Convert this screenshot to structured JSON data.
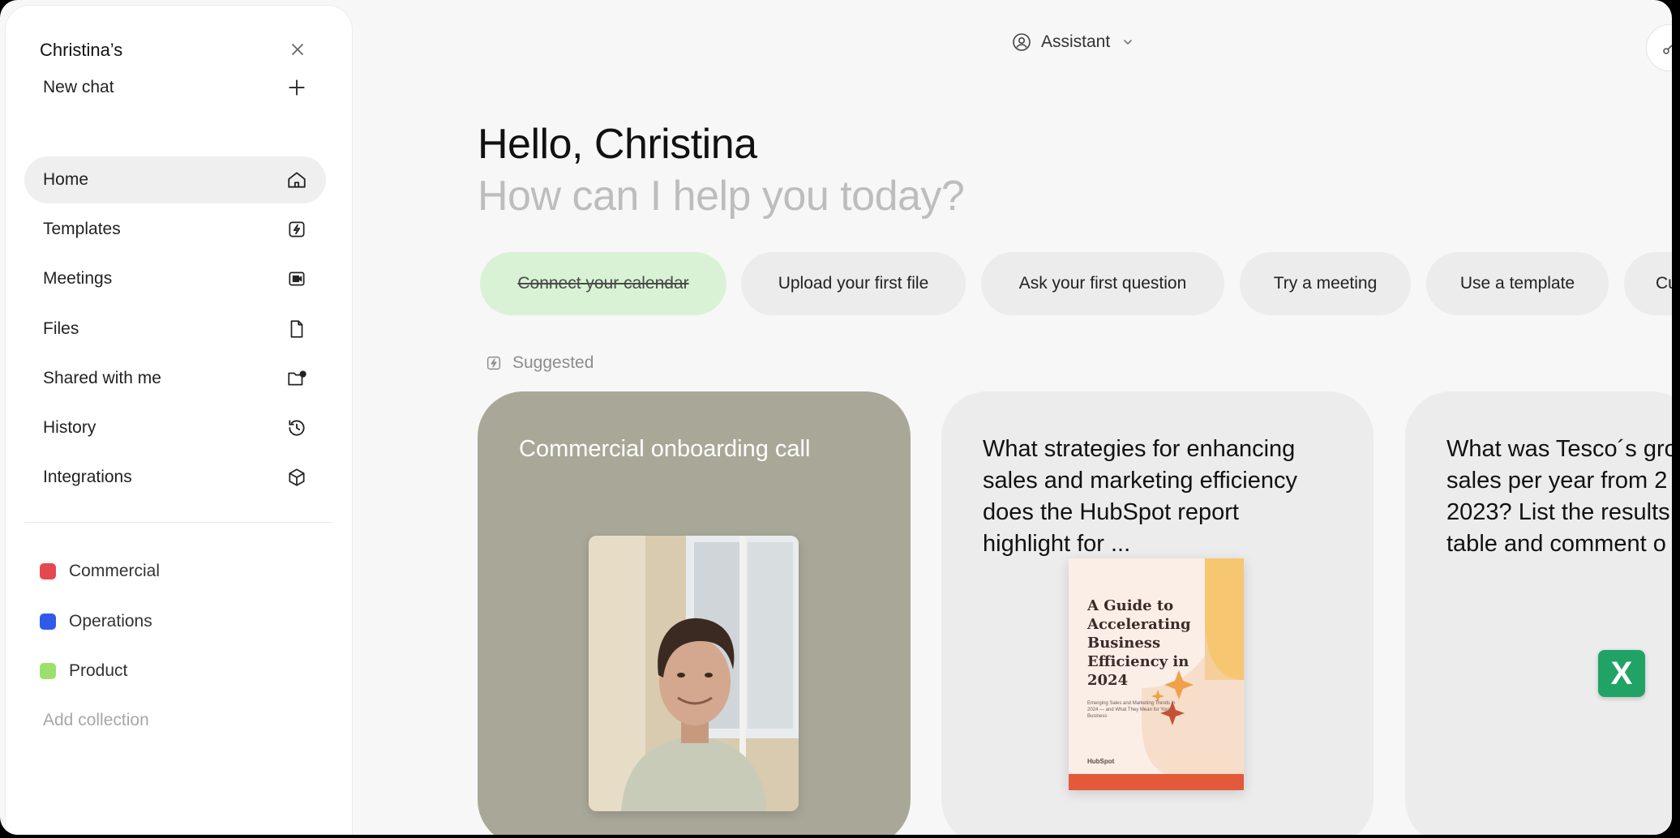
{
  "sidebar": {
    "workspace": "Christina’s",
    "new_chat": "New chat",
    "nav": [
      {
        "label": "Home",
        "icon": "home-icon",
        "active": true
      },
      {
        "label": "Templates",
        "icon": "lightning-icon"
      },
      {
        "label": "Meetings",
        "icon": "video-icon"
      },
      {
        "label": "Files",
        "icon": "file-icon"
      },
      {
        "label": "Shared with me",
        "icon": "shared-folder-icon"
      },
      {
        "label": "History",
        "icon": "history-icon"
      },
      {
        "label": "Integrations",
        "icon": "cube-icon"
      }
    ],
    "collections": [
      {
        "label": "Commercial",
        "color": "#e5484d"
      },
      {
        "label": "Operations",
        "color": "#2f5bea"
      },
      {
        "label": "Product",
        "color": "#9be06a"
      }
    ],
    "add_collection": "Add collection"
  },
  "header": {
    "assistant_label": "Assistant"
  },
  "greeting": {
    "title": "Hello, Christina",
    "subtitle": "How can I help you today?"
  },
  "chips": [
    {
      "label": "Connect your calendar",
      "done": true
    },
    {
      "label": "Upload your first file"
    },
    {
      "label": "Ask your first question"
    },
    {
      "label": "Try a meeting"
    },
    {
      "label": "Use a template"
    },
    {
      "label": "Cu"
    }
  ],
  "suggested": {
    "label": "Suggested",
    "cards": [
      {
        "title": "Commercial onboarding call"
      },
      {
        "title": "What strategies for enhancing sales and marketing efficiency does the HubSpot report highlight for ..."
      },
      {
        "title": "What was Tesco´s gro sales per year from 2 2023? List the results table and comment o"
      }
    ],
    "guide": {
      "title": "A Guide to Accelerating Business Efficiency in 2024",
      "subtitle": "Emerging Sales and Marketing Trends in 2024 — and What They Mean for Your Business",
      "brand": "HubSpot"
    },
    "excel_badge": "X"
  },
  "colors": {
    "accent_green_chip": "#d9f2d5",
    "video_card": "#a9a898",
    "excel": "#21a366"
  }
}
